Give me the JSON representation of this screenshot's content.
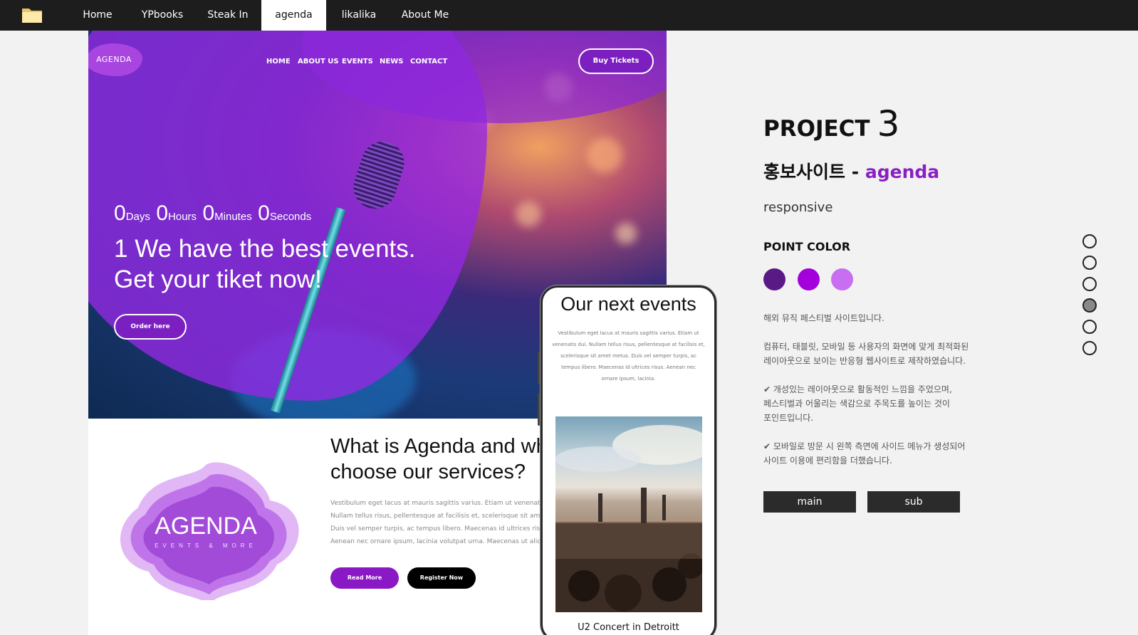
{
  "nav": {
    "items": [
      {
        "label": "Home"
      },
      {
        "label": "YPbooks"
      },
      {
        "label": "Steak In"
      },
      {
        "label": "agenda",
        "active": true
      },
      {
        "label": "likalika"
      },
      {
        "label": "About Me"
      }
    ]
  },
  "desktop": {
    "logo": "AGENDA",
    "menu": [
      "HOME",
      "ABOUT US",
      "EVENTS",
      "NEWS",
      "CONTACT"
    ],
    "buy_tickets": "Buy Tickets",
    "counter": [
      {
        "n": "0",
        "unit": "Days"
      },
      {
        "n": "0",
        "unit": "Hours"
      },
      {
        "n": "0",
        "unit": "Minutes"
      },
      {
        "n": "0",
        "unit": "Seconds"
      }
    ],
    "headline_1": "1 We have the best events.",
    "headline_2": "Get your tiket now!",
    "order_button": "Order here",
    "about_logo_main": "AGENDA",
    "about_logo_sub": "EVENTS & MORE",
    "about_title_1": "What is Agenda and why",
    "about_title_2": "choose our services?",
    "about_body": [
      "Vestibulum eget lacus at mauris sagittis varius. Etiam ut venenatis",
      "Nullam tellus risus, pellentesque at facilisis et, scelerisque sit amet",
      "Duis vel semper turpis, ac tempus libero. Maecenas id ultrices risus",
      "Aenean nec ornare ipsum, lacinia volutpat urna. Maecenas ut aliquet"
    ],
    "read_more": "Read More",
    "register_now": "Register Now"
  },
  "mobile": {
    "title": "Our next events",
    "body": [
      "Vestibulum eget lacus at mauris sagittis varius. Etiam ut",
      "venenatis dui. Nullam tellus risus, pellentesque at facilisis et,",
      "scelerisque sit amet metus. Duis vel semper turpis, ac",
      "tempus libero. Maecenas id ultrices risus. Aenean nec",
      "ornare ipsum, lacinia."
    ],
    "caption": "U2 Concert in Detroitt"
  },
  "project": {
    "word": "PROJECT",
    "number": "3",
    "subtitle_ko": "홍보사이트",
    "dash": "-",
    "subtitle_name": "agenda",
    "type": "responsive",
    "point_color_label": "POINT COLOR",
    "colors": [
      "#5a1a85",
      "#a400dc",
      "#c86ef0"
    ],
    "desc_1": "해외 뮤직 페스티벌 사이트입니다.",
    "desc_2a": "컴퓨터, 태블릿, 모바일 등 사용자의 화면에 맞게 최적화된",
    "desc_2b": "레이아웃으로 보이는 반응형 웹사이트로 제작하였습니다.",
    "desc_3a": "✔ 개성있는 레이아웃으로 활동적인 느낌을 주었으며,",
    "desc_3b": "페스티벌과 어울리는 색감으로 주목도를 높이는 것이",
    "desc_3c": "포인트입니다.",
    "desc_4a": "✔ 모바일로 방문 시 왼쪽 측면에 사이드 메뉴가 생성되어",
    "desc_4b": "사이트 이용에 편리함을 더했습니다.",
    "main_button": "main",
    "sub_button": "sub"
  },
  "pager": {
    "count": 6,
    "active_index": 3
  },
  "accent_color": "#8a1fc4"
}
